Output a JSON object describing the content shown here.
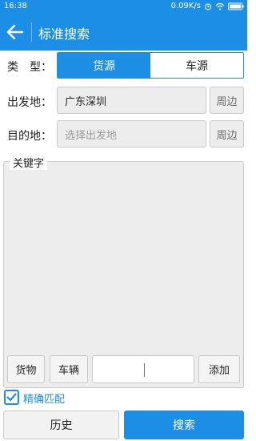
{
  "status": {
    "time": "16:38",
    "speed": "0.09K/s",
    "battery_icon": "battery-icon",
    "wifi_icon": "wifi-icon",
    "alarm_icon": "alarm-icon"
  },
  "header": {
    "title": "标准搜索",
    "back_icon": "arrow-left-icon"
  },
  "type_row": {
    "label": "类　型：",
    "options": [
      "货源",
      "车源"
    ],
    "selected": "货源"
  },
  "origin": {
    "label": "出发地：",
    "value": "广东深圳",
    "nearby": "周边"
  },
  "destination": {
    "label": "目的地：",
    "placeholder": "选择出发地",
    "nearby": "周边"
  },
  "keywords": {
    "legend": "关键字",
    "goods": "货物",
    "vehicle": "车辆",
    "add": "添加",
    "input_value": ""
  },
  "exact_match": {
    "label": "精确匹配",
    "checked": true
  },
  "actions": {
    "history": "历史",
    "search": "搜索"
  },
  "colors": {
    "accent": "#1c8ee6"
  }
}
